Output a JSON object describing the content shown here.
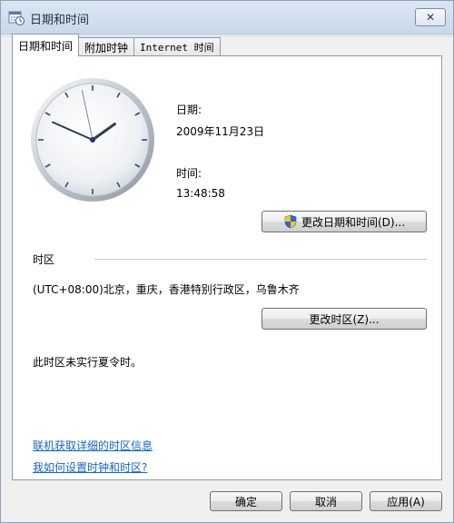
{
  "window": {
    "title": "日期和时间",
    "close_glyph": "✕"
  },
  "tabs": [
    {
      "label": "日期和时间"
    },
    {
      "label": "附加时钟"
    },
    {
      "label": "Internet 时间"
    }
  ],
  "datetime": {
    "date_label": "日期:",
    "date_value": "2009年11月23日",
    "time_label": "时间:",
    "time_value": "13:48:58",
    "change_button": "更改日期和时间(D)..."
  },
  "timezone": {
    "section_label": "时区",
    "value": "(UTC+08:00)北京，重庆，香港特别行政区，乌鲁木齐",
    "change_button": "更改时区(Z)...",
    "dst_note": "此时区未实行夏令时。"
  },
  "links": {
    "online_info": "联机获取详细的时区信息",
    "how_to": "我如何设置时钟和时区?"
  },
  "footer": {
    "ok": "确定",
    "cancel": "取消",
    "apply": "应用(A)"
  },
  "clock": {
    "hours": 13,
    "minutes": 48,
    "seconds": 58
  },
  "colors": {
    "accent": "#1565c8",
    "shield_blue": "#2b6cc4",
    "shield_yellow": "#f2c230"
  }
}
